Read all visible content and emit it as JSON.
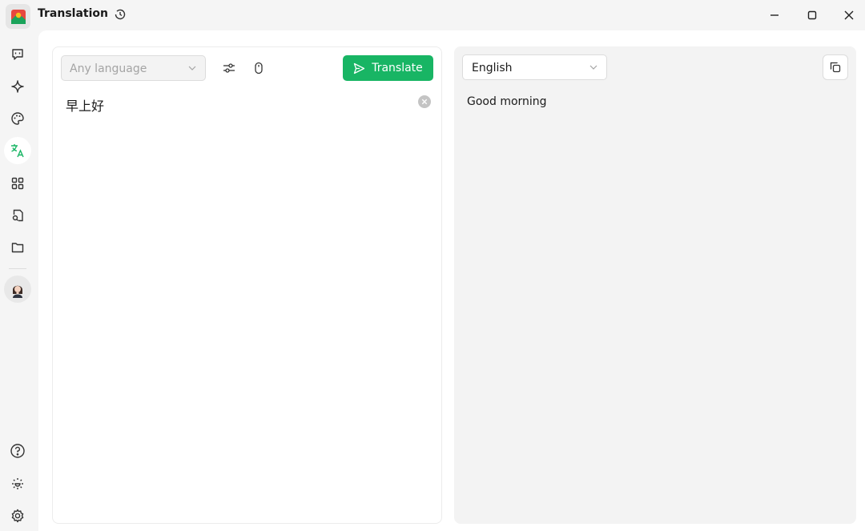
{
  "app": {
    "title": "Translation",
    "logo_icon": "app-logo",
    "accent_color": "#18b564"
  },
  "sidebar": {
    "items": [
      {
        "name": "chat",
        "icon": "chat-icon"
      },
      {
        "name": "assistant",
        "icon": "sparkle-icon"
      },
      {
        "name": "painting",
        "icon": "palette-icon"
      },
      {
        "name": "translate",
        "icon": "translate-icon",
        "active": true
      },
      {
        "name": "apps",
        "icon": "grid-icon"
      },
      {
        "name": "files",
        "icon": "file-search-icon"
      },
      {
        "name": "folder",
        "icon": "folder-icon"
      }
    ],
    "bottom": [
      "help-icon",
      "theme-icon",
      "settings-icon"
    ]
  },
  "source": {
    "language_placeholder": "Any language",
    "translate_label": "Translate",
    "text": "早上好"
  },
  "target": {
    "language": "English",
    "text": "Good morning"
  }
}
